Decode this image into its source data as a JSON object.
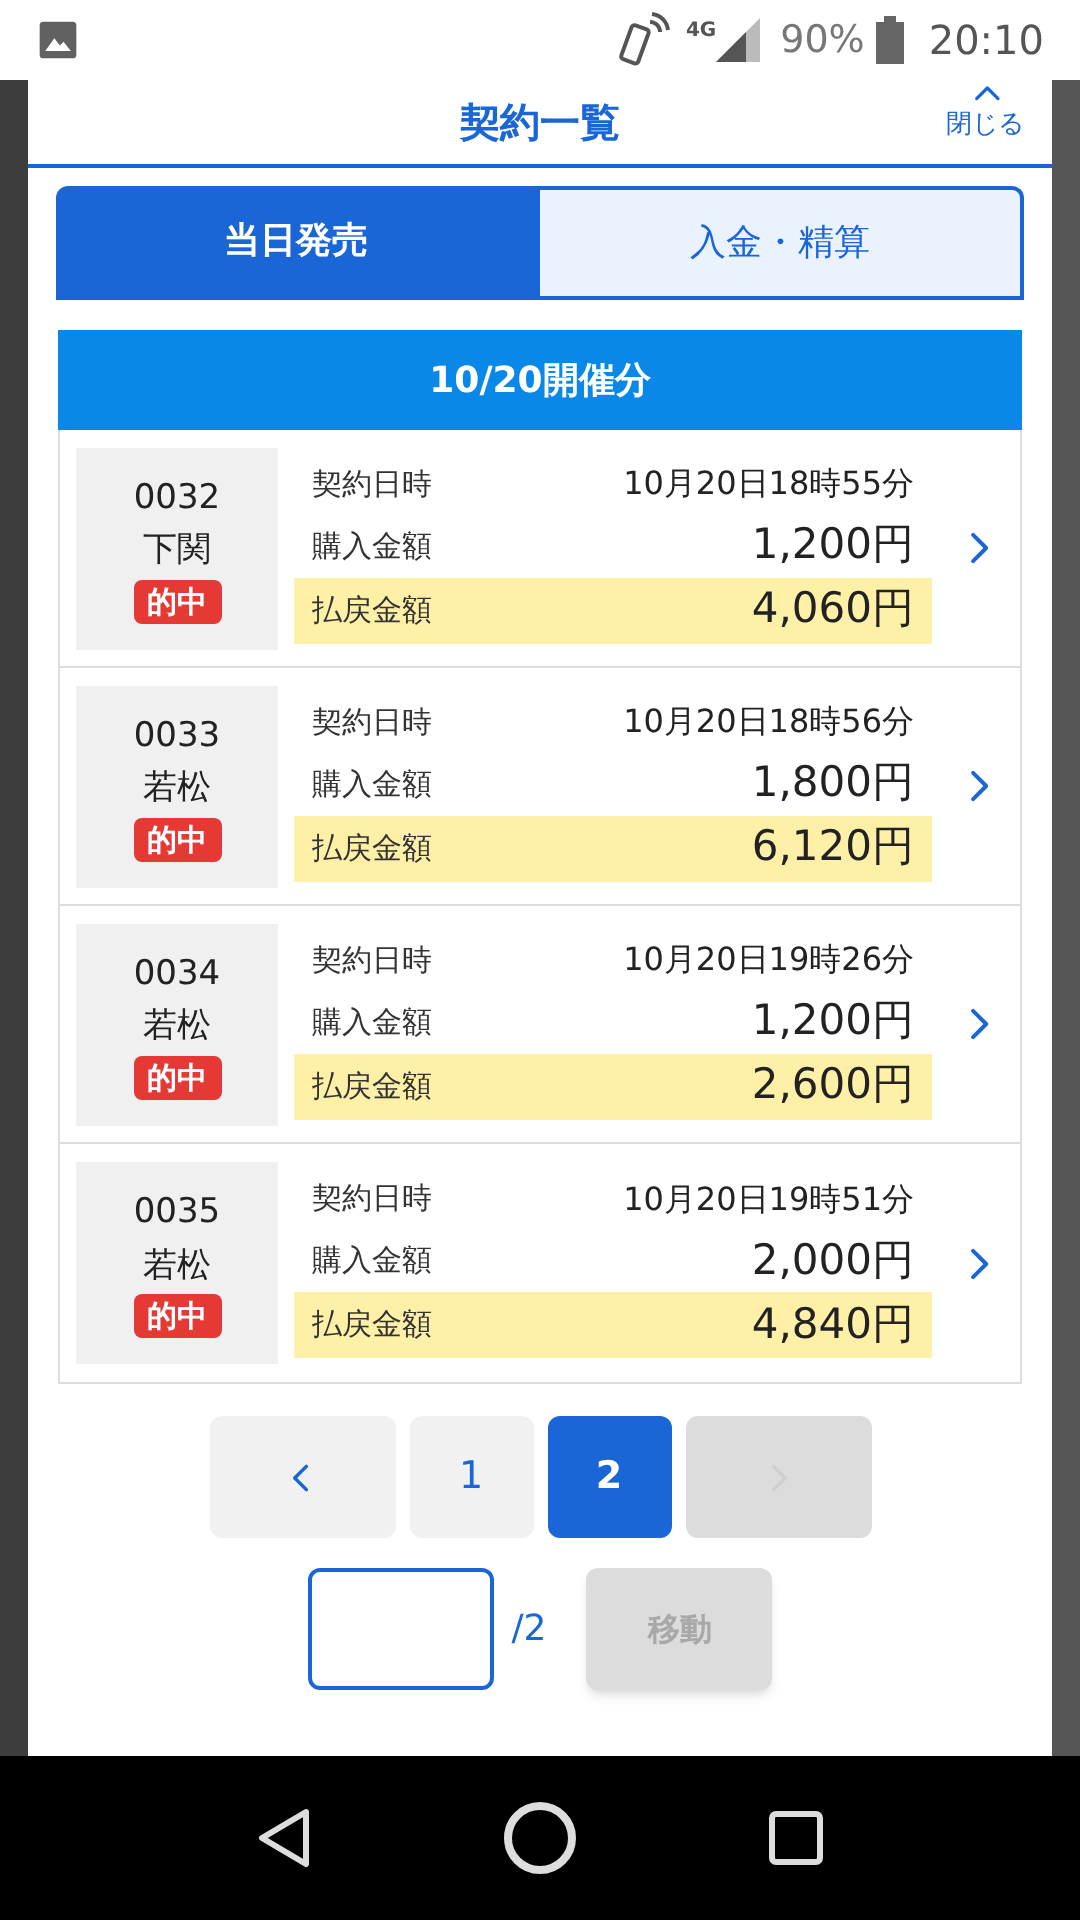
{
  "status_bar": {
    "network": "4G",
    "battery": "90%",
    "time": "20:10"
  },
  "header": {
    "title": "契約一覧",
    "close_label": "閉じる"
  },
  "tabs": [
    {
      "label": "当日発売",
      "selected": true
    },
    {
      "label": "入金・精算",
      "selected": false
    }
  ],
  "section_title": "10/20開催分",
  "contracts": [
    {
      "number": "0032",
      "venue": "下関",
      "result": "的中",
      "fields": [
        {
          "label": "契約日時",
          "value": "10月20日18時55分",
          "highlighted": false
        },
        {
          "label": "購入金額",
          "value": "1,200円",
          "highlighted": false
        },
        {
          "label": "払戻金額",
          "value": "4,060円",
          "highlighted": true
        }
      ]
    },
    {
      "number": "0033",
      "venue": "若松",
      "result": "的中",
      "fields": [
        {
          "label": "契約日時",
          "value": "10月20日18時56分",
          "highlighted": false
        },
        {
          "label": "購入金額",
          "value": "1,800円",
          "highlighted": false
        },
        {
          "label": "払戻金額",
          "value": "6,120円",
          "highlighted": true
        }
      ]
    },
    {
      "number": "0034",
      "venue": "若松",
      "result": "的中",
      "fields": [
        {
          "label": "契約日時",
          "value": "10月20日19時26分",
          "highlighted": false
        },
        {
          "label": "購入金額",
          "value": "1,200円",
          "highlighted": false
        },
        {
          "label": "払戻金額",
          "value": "2,600円",
          "highlighted": true
        }
      ]
    },
    {
      "number": "0035",
      "venue": "若松",
      "result": "的中",
      "fields": [
        {
          "label": "契約日時",
          "value": "10月20日19時51分",
          "highlighted": false
        },
        {
          "label": "購入金額",
          "value": "2,000円",
          "highlighted": false
        },
        {
          "label": "払戻金額",
          "value": "4,840円",
          "highlighted": true
        }
      ]
    }
  ],
  "pagination": {
    "prev_disabled": false,
    "pages": [
      {
        "label": "1",
        "selected": false
      },
      {
        "label": "2",
        "selected": true
      }
    ],
    "next_disabled": true
  },
  "page_jump": {
    "total": "/2",
    "button": {
      "label": "移動",
      "disabled": true
    }
  }
}
